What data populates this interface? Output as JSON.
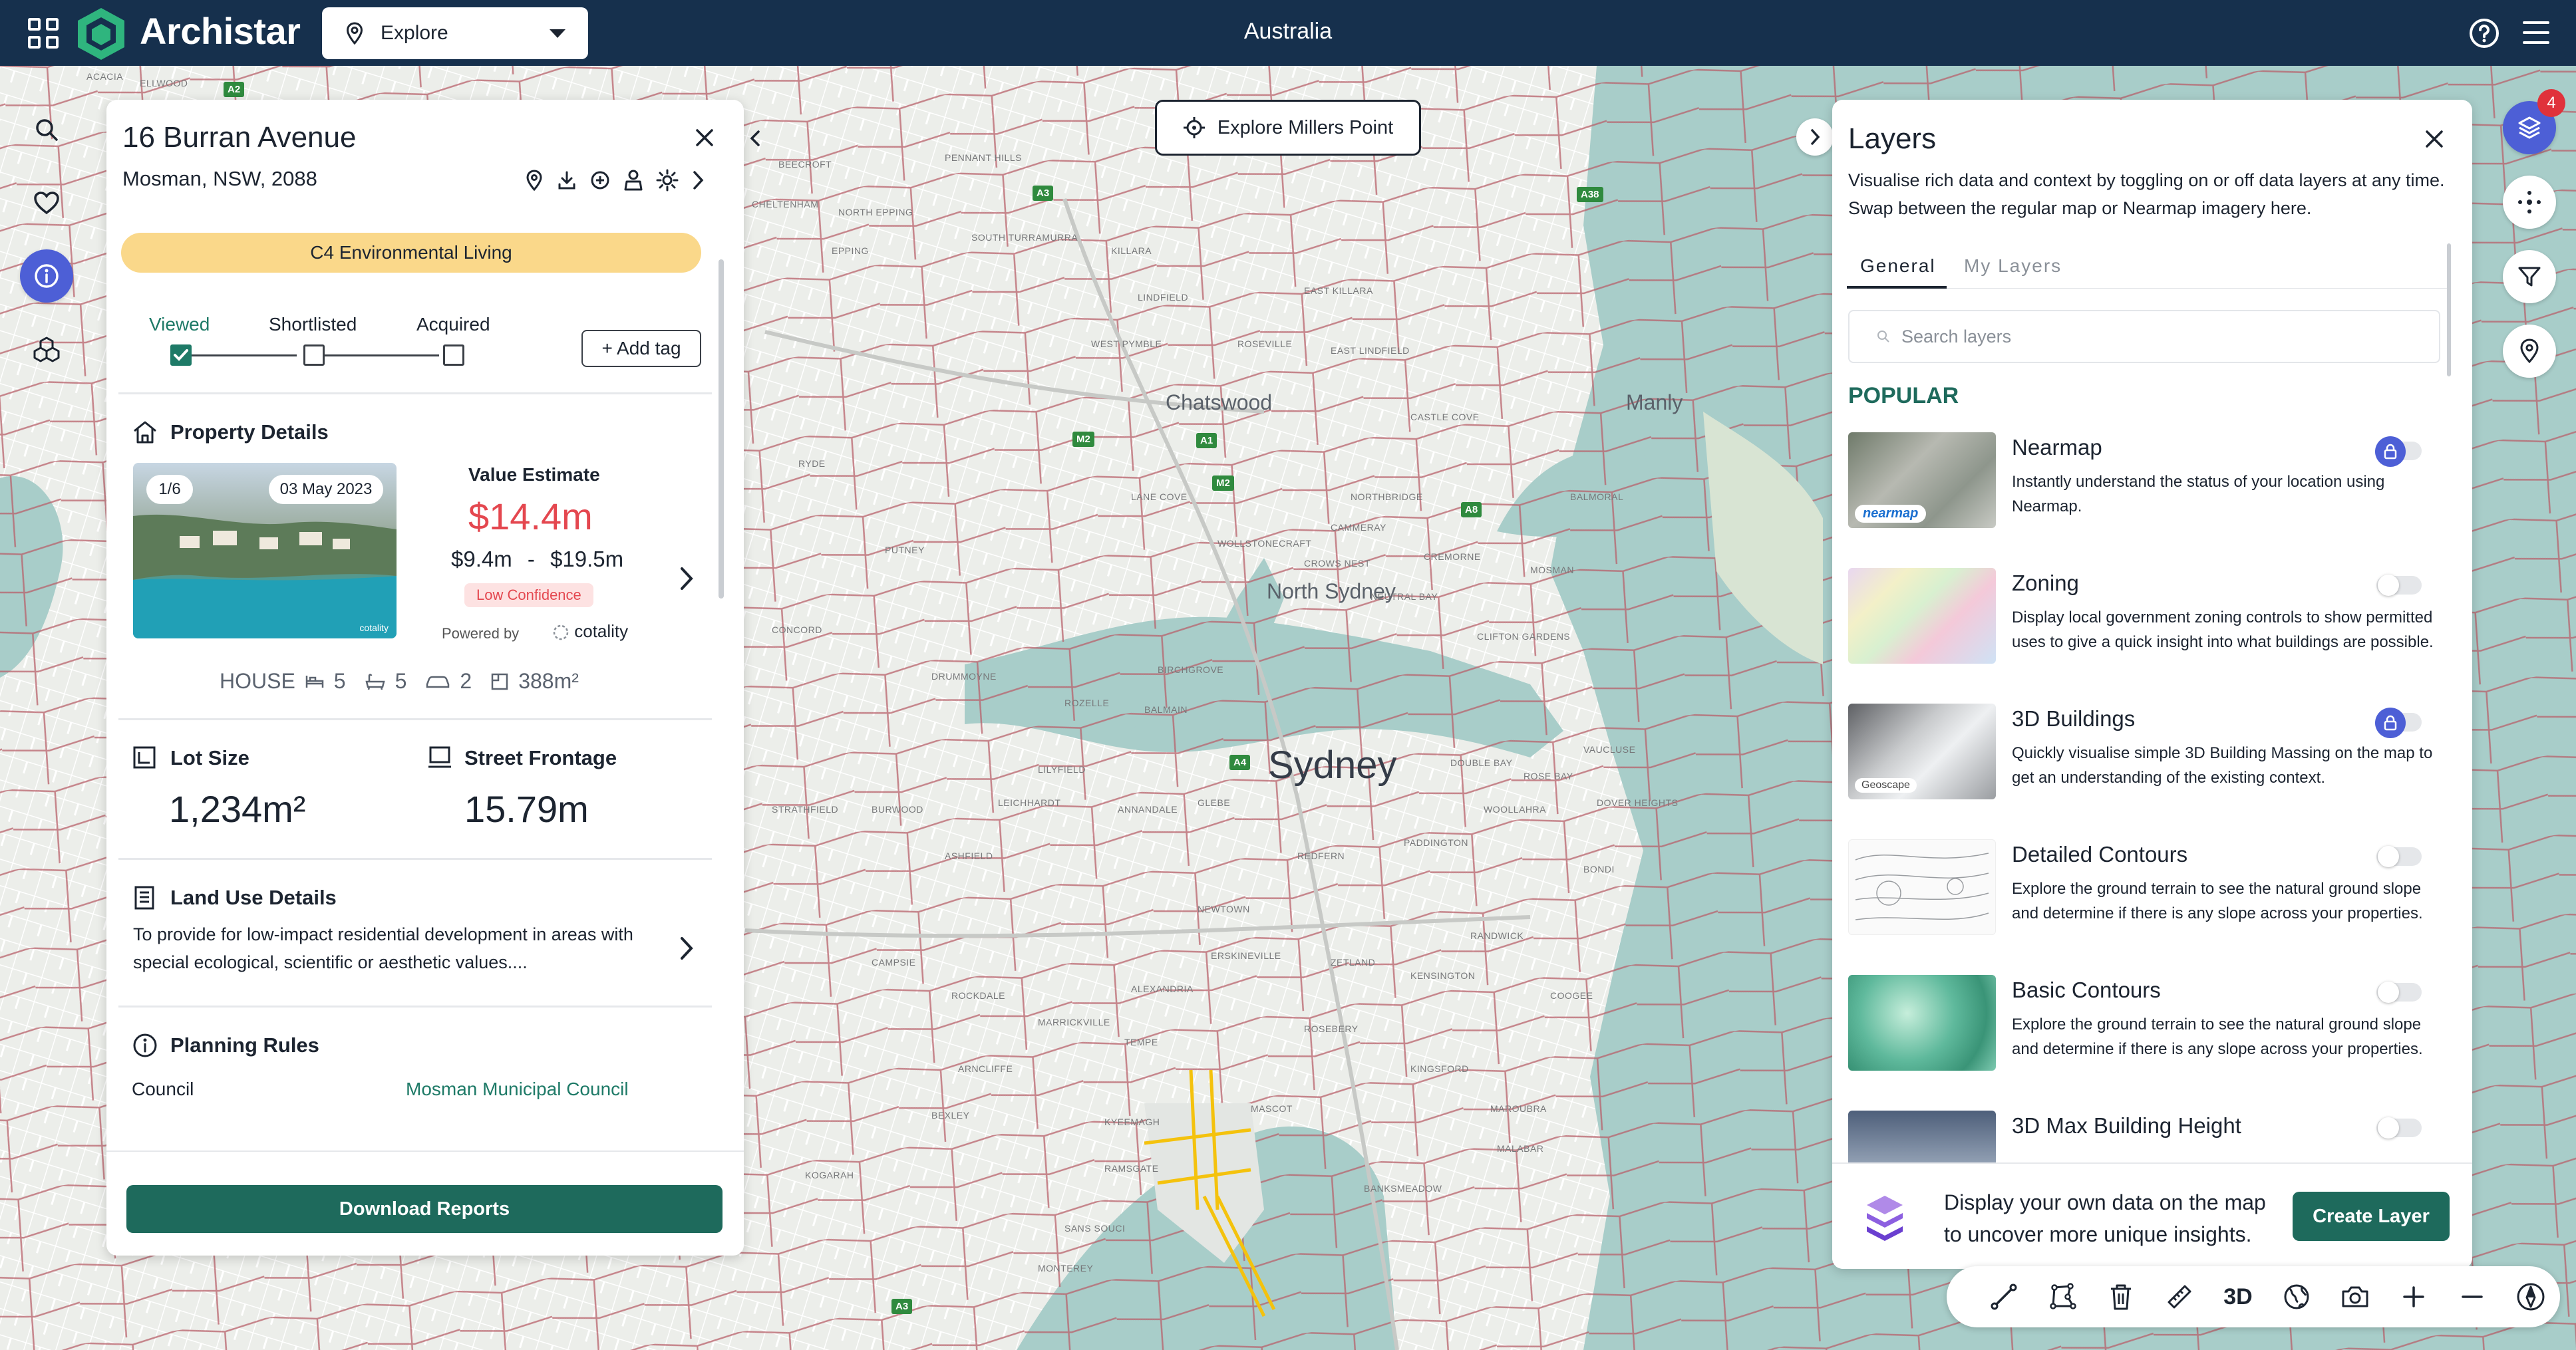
{
  "header": {
    "brand": "Archistar",
    "mode_dropdown": "Explore",
    "country": "Australia"
  },
  "map": {
    "city_label": "Sydney",
    "suburbs_major": [
      "Chatswood",
      "North Sydney",
      "Manly"
    ],
    "suburbs": [
      "ACACIA",
      "ELLWOOD",
      "NORTH EPPING",
      "EPPING",
      "CHELTENHAM",
      "BEECROFT",
      "PENNANT HILLS",
      "SOUTH TURRAMURRA",
      "WEST PYMBLE",
      "KILLARA",
      "LINDFIELD",
      "ROSEVILLE",
      "EAST KILLARA",
      "EAST LINDFIELD",
      "CASTLE COVE",
      "NORTHBRIDGE",
      "CAMMERAY",
      "CREMORNE",
      "NEUTRAL BAY",
      "MOSMAN",
      "BALMORAL",
      "CLIFTON GARDENS",
      "WOLLSTONECRAFT",
      "CROWS NEST",
      "LANE COVE",
      "RYDE",
      "PUTNEY",
      "CONCORD",
      "DRUMMOYNE",
      "BIRCHGROVE",
      "BALMAIN",
      "ROZELLE",
      "LILYFIELD",
      "LEICHHARDT",
      "ANNANDALE",
      "GLEBE",
      "STRATHFIELD",
      "BURWOOD",
      "ASHFIELD",
      "NEWTOWN",
      "ERSKINEVILLE",
      "ALEXANDRIA",
      "REDFERN",
      "ZETLAND",
      "ROSEBERY",
      "MASCOT",
      "KENSINGTON",
      "KINGSFORD",
      "MAROUBRA",
      "CAMPSIE",
      "MARRICKVILLE",
      "TEMPE",
      "ARNCLIFFE",
      "KOGARAH",
      "RAMSGATE",
      "SANS SOUCI",
      "BEXLEY",
      "ROCKDALE",
      "PADDINGTON",
      "WOOLLAHRA",
      "BONDI",
      "VAUCLUSE",
      "DOUBLE BAY",
      "ROSE BAY",
      "DOVER HEIGHTS",
      "RANDWICK",
      "COOGEE",
      "MALABAR",
      "BANKSMEADOW",
      "KYEEMAGH",
      "MONTEREY"
    ],
    "road_shields": [
      "M2",
      "A3",
      "A1",
      "M2",
      "A8",
      "A38",
      "A4",
      "A3",
      "A2"
    ],
    "explore_button": "Explore Millers Point"
  },
  "property_panel": {
    "address": "16 Burran Avenue",
    "locality": "Mosman, NSW, 2088",
    "zoning": "C4 Environmental Living",
    "tracking": {
      "steps": [
        "Viewed",
        "Shortlisted",
        "Acquired"
      ],
      "current_index": 0
    },
    "add_tag": "+ Add tag",
    "property_details_title": "Property Details",
    "photo_counter": "1/6",
    "photo_date": "03 May 2023",
    "photo_credit": "cotality",
    "value_label": "Value Estimate",
    "value": "$14.4m",
    "range_low": "$9.4m",
    "range_sep": "-",
    "range_high": "$19.5m",
    "confidence": "Low Confidence",
    "powered_by": "Powered by",
    "provider": "cotality",
    "type": "HOUSE",
    "bedrooms": "5",
    "bathrooms": "5",
    "parking": "2",
    "floor_area": "388m²",
    "lot_size_label": "Lot Size",
    "lot_size": "1,234m²",
    "frontage_label": "Street Frontage",
    "frontage": "15.79m",
    "land_use_title": "Land Use Details",
    "land_use_text": "To provide for low-impact residential development in areas with special ecological, scientific or aesthetic values....",
    "planning_title": "Planning Rules",
    "council_label": "Council",
    "council_value": "Mosman Municipal Council",
    "download_button": "Download Reports"
  },
  "layers_panel": {
    "title": "Layers",
    "description": "Visualise rich data and context by toggling on or off data layers at any time. Swap between the regular map or Nearmap imagery here.",
    "tabs": [
      "General",
      "My Layers"
    ],
    "search_placeholder": "Search layers",
    "section": "POPULAR",
    "items": [
      {
        "name": "Nearmap",
        "desc": "Instantly understand the status of your location using Nearmap.",
        "locked": true,
        "thumb_text": "nearmap"
      },
      {
        "name": "Zoning",
        "desc": "Display local government zoning controls to show permitted uses to give a quick insight into what buildings are possible.",
        "locked": false
      },
      {
        "name": "3D Buildings",
        "desc": "Quickly visualise simple 3D Building Massing on the map to get an understanding of the existing context.",
        "locked": true,
        "thumb_text": "Geoscape"
      },
      {
        "name": "Detailed Contours",
        "desc": "Explore the ground terrain to see the natural ground slope and determine if there is any slope across your properties.",
        "locked": false
      },
      {
        "name": "Basic Contours",
        "desc": "Explore the ground terrain to see the natural ground slope and determine if there is any slope across your properties.",
        "locked": false
      },
      {
        "name": "3D Max Building Height",
        "desc": "",
        "locked": false
      }
    ],
    "promo_text": "Display your own data on the map to uncover more unique insights.",
    "create_button": "Create Layer"
  },
  "right_rail": {
    "notification_count": "4"
  },
  "toolbar": {
    "three_d": "3D"
  },
  "colors": {
    "header": "#16304d",
    "accent": "#1e6a5c",
    "primary_blue": "#4d5fd6",
    "value_red": "#e4474f",
    "zoning_badge": "#fad88a"
  }
}
